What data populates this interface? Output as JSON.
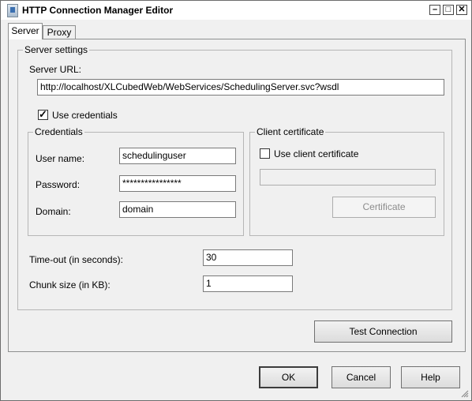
{
  "window": {
    "title": "HTTP Connection Manager Editor"
  },
  "tabs": [
    {
      "label": "Server"
    },
    {
      "label": "Proxy"
    }
  ],
  "server_settings": {
    "legend": "Server settings",
    "url_label": "Server URL:",
    "url_value": "http://localhost/XLCubedWeb/WebServices/SchedulingServer.svc?wsdl",
    "use_credentials_label": "Use credentials",
    "use_credentials_checked": true
  },
  "credentials": {
    "legend": "Credentials",
    "username_label": "User name:",
    "username_value": "schedulinguser",
    "password_label": "Password:",
    "password_value": "****************",
    "domain_label": "Domain:",
    "domain_value": "domain"
  },
  "client_certificate": {
    "legend": "Client certificate",
    "use_label": "Use client certificate",
    "use_checked": false,
    "certificate_value": "",
    "certificate_button": "Certificate"
  },
  "timeout": {
    "label": "Time-out (in seconds):",
    "value": "30"
  },
  "chunk": {
    "label": "Chunk size (in KB):",
    "value": "1"
  },
  "buttons": {
    "test": "Test Connection",
    "ok": "OK",
    "cancel": "Cancel",
    "help": "Help"
  }
}
